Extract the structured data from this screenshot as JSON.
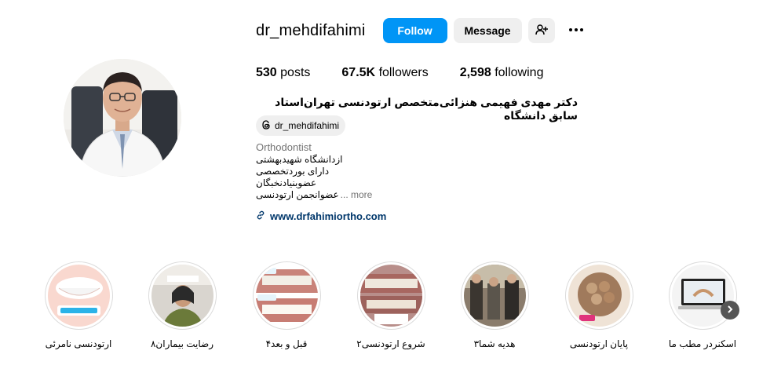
{
  "profile": {
    "username": "dr_mehdifahimi",
    "follow_label": "Follow",
    "message_label": "Message",
    "stats": {
      "posts_count": "530",
      "posts_label": "posts",
      "followers_count": "67.5K",
      "followers_label": "followers",
      "following_count": "2,598",
      "following_label": "following"
    },
    "full_name": "دکتر مهدی فهیمی هنزائی‌متخصص ارتودنسی تهران‌استاد سابق دانشگاه",
    "threads_handle": "dr_mehdifahimi",
    "category": "Orthodontist",
    "bio_lines": [
      "ازدانشگاه شهیدبهشتی",
      "دارای بوردتخصصی",
      "عضوبنیادنخبگان",
      "عضوانجمن ارتودنسی"
    ],
    "bio_more": "... more",
    "website": "www.drfahimiortho.com"
  },
  "highlights": [
    {
      "label": "ارتودنسی نامرئی",
      "icon": "invisible-aligner-thumb"
    },
    {
      "label": "رضایت بیماران۸",
      "icon": "patient-satisfaction-thumb"
    },
    {
      "label": "قبل و بعد۴",
      "icon": "before-after-thumb"
    },
    {
      "label": "شروع ارتودنسی۲",
      "icon": "start-orthodontics-thumb"
    },
    {
      "label": "هدیه شما۳",
      "icon": "your-gift-thumb"
    },
    {
      "label": "پایان ارتودنسی",
      "icon": "end-orthodontics-thumb"
    },
    {
      "label": "اسکنردر مطب ما",
      "icon": "office-scanner-thumb"
    }
  ],
  "colors": {
    "follow_blue": "#0095f6",
    "button_gray": "#efefef",
    "link_blue": "#00376b",
    "muted_text": "#737373"
  }
}
